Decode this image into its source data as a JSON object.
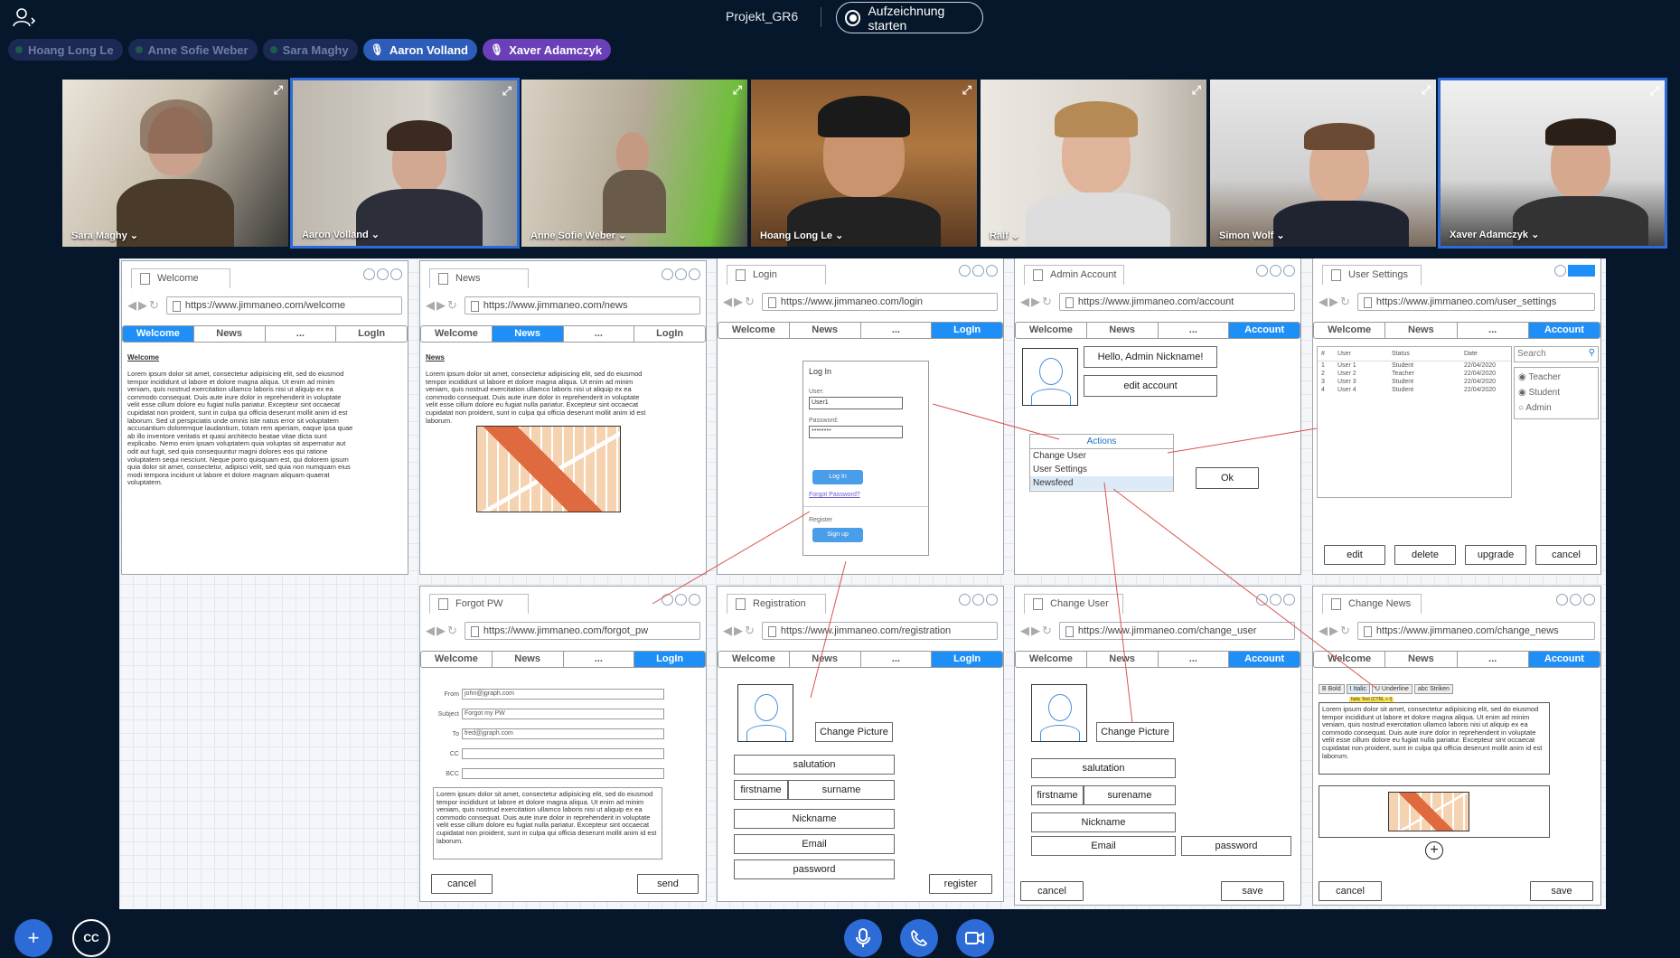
{
  "meeting": {
    "title": "Projekt_GR6",
    "record_label": "Aufzeichnung starten"
  },
  "speakers": [
    {
      "name": "Hoang Long Le",
      "style": "dim"
    },
    {
      "name": "Anne Sofie Weber",
      "style": "dim"
    },
    {
      "name": "Sara Maghy",
      "style": "dim"
    },
    {
      "name": "Aaron Volland",
      "style": "mic"
    },
    {
      "name": "Xaver Adamczyk",
      "style": "mic-purple"
    }
  ],
  "tiles": [
    {
      "name": "Sara Maghy ⌄"
    },
    {
      "name": "Aaron Volland ⌄"
    },
    {
      "name": "Anne Sofie Weber ⌄"
    },
    {
      "name": "Hoang Long Le ⌄"
    },
    {
      "name": "Ralf ⌄"
    },
    {
      "name": "Simon Wolf ⌄"
    },
    {
      "name": "Xaver Adamczyk ⌄"
    }
  ],
  "nav": {
    "welcome": "Welcome",
    "news": "News",
    "dots": "...",
    "login": "LogIn",
    "account": "Account"
  },
  "wireframes": {
    "welcome": {
      "tab": "Welcome",
      "url": "https://www.jimmaneo.com/welcome",
      "heading": "Welcome",
      "text": "Lorem ipsum dolor sit amet, consectetur adipisicing elit, sed do eiusmod tempor incididunt ut labore et dolore magna aliqua. Ut enim ad minim veniam, quis nostrud exercitation ullamco laboris nisi ut aliquip ex ea commodo consequat. Duis aute irure dolor in reprehenderit in voluptate velit esse cillum dolore eu fugiat nulla pariatur. Excepteur sint occaecat cupidatat non proident, sunt in culpa qui officia deserunt mollit anim id est laborum. Sed ut perspiciatis unde omnis iste natus error sit voluptatem accusantium doloremque laudantium, totam rem aperiam, eaque ipsa quae ab illo inventore veritatis et quasi architecto beatae vitae dicta sunt explicabo. Nemo enim ipsam voluptatem quia voluptas sit aspernatur aut odit aut fugit, sed quia consequuntur magni dolores eos qui ratione voluptatem sequi nesciunt. Neque porro quisquam est, qui dolorem ipsum quia dolor sit amet, consectetur, adipisci velit, sed quia non numquam eius modi tempora incidunt ut labore et dolore magnam aliquam quaerat voluptatem."
    },
    "news": {
      "tab": "News",
      "url": "https://www.jimmaneo.com/news",
      "heading": "News",
      "text": "Lorem ipsum dolor sit amet, consectetur adipisicing elit, sed do eiusmod tempor incididunt ut labore et dolore magna aliqua. Ut enim ad minim veniam, quis nostrud exercitation ullamco laboris nisi ut aliquip ex ea commodo consequat. Duis aute irure dolor in reprehenderit in voluptate velit esse cillum dolore eu fugiat nulla pariatur. Excepteur sint occaecat cupidatat non proident, sunt in culpa qui officia deserunt mollit anim id est laborum."
    },
    "login": {
      "tab": "Login",
      "url": "https://www.jimmaneo.com/login",
      "box_title": "Log In",
      "user_label": "User:",
      "user_value": "User1",
      "password_label": "Password:",
      "password_value": "********",
      "login_btn": "Log In",
      "forgot": "Forgot Password?",
      "register_label": "Register",
      "signup_btn": "Sign up"
    },
    "admin": {
      "tab": "Admin Account",
      "url": "https://www.jimmaneo.com/account",
      "hello": "Hello, Admin Nickname!",
      "edit": "edit account",
      "actions_title": "Actions",
      "actions": [
        "Change User",
        "User Settings",
        "Newsfeed"
      ],
      "ok": "Ok"
    },
    "user_settings": {
      "tab": "User Settings",
      "url": "https://www.jimmaneo.com/user_settings",
      "cols": [
        "#",
        "User",
        "Status",
        "Date"
      ],
      "rows": [
        [
          "1",
          "User 1",
          "Student",
          "22/04/2020"
        ],
        [
          "2",
          "User 2",
          "Teacher",
          "22/04/2020"
        ],
        [
          "3",
          "User 3",
          "Student",
          "22/04/2020"
        ],
        [
          "4",
          "User 4",
          "Student",
          "22/04/2020"
        ]
      ],
      "search": "Search",
      "roles": [
        "Teacher",
        "Student",
        "Admin"
      ],
      "buttons": [
        "edit",
        "delete",
        "upgrade",
        "cancel"
      ]
    },
    "forgot": {
      "tab": "Forgot PW",
      "url": "https://www.jimmaneo.com/forgot_pw",
      "fields": [
        {
          "label": "From",
          "value": "john@jgraph.com"
        },
        {
          "label": "Subject",
          "value": "Forgot my PW"
        },
        {
          "label": "To",
          "value": "fred@jgraph.com"
        },
        {
          "label": "CC",
          "value": ""
        },
        {
          "label": "BCC",
          "value": ""
        }
      ],
      "text": "Lorem ipsum dolor sit amet, consectetur adipisicing elit, sed do eiusmod tempor incididunt ut labore et dolore magna aliqua. Ut enim ad minim veniam, quis nostrud exercitation ullamco laboris nisi ut aliquip ex ea commodo consequat. Duis aute irure dolor in reprehenderit in voluptate velit esse cillum dolore eu fugiat nulla pariatur. Excepteur sint occaecat cupidatat non proident, sunt in culpa qui officia deserunt mollit anim id est laborum.",
      "cancel": "cancel",
      "send": "send"
    },
    "registration": {
      "tab": "Registration",
      "url": "https://www.jimmaneo.com/registration",
      "change_picture": "Change Picture",
      "salutation": "salutation",
      "firstname": "firstname",
      "surname": "surname",
      "nickname": "Nickname",
      "email": "Email",
      "password": "password",
      "register": "register"
    },
    "change_user": {
      "tab": "Change User",
      "url": "https://www.jimmaneo.com/change_user",
      "change_picture": "Change Picture",
      "salutation": "salutation",
      "firstname": "firstname",
      "surname": "surename",
      "nickname": "Nickname",
      "email": "Email",
      "password": "password",
      "cancel": "cancel",
      "save": "save"
    },
    "change_news": {
      "tab": "Change News",
      "url": "https://www.jimmaneo.com/change_news",
      "toolbar": [
        "B Bold",
        "I Italic",
        "U Underline",
        "abc Striken"
      ],
      "tooltip": "Italic Text (CTRL + I)",
      "text": "Lorem ipsum dolor sit amet, consectetur adipisicing elit, sed do eiusmod tempor incididunt ut labore et dolore magna aliqua. Ut enim ad minim veniam, quis nostrud exercitation ullamco laboris nisi ut aliquip ex ea commodo consequat. Duis aute irure dolor in reprehenderit in voluptate velit esse cillum dolore eu fugiat nulla pariatur. Excepteur sint occaecat cupidatat non proident, sunt in culpa qui officia deserunt mollit anim id est laborum.",
      "add": "+",
      "cancel": "cancel",
      "save": "save"
    }
  },
  "bottom": {
    "cc": "CC"
  },
  "colors": {
    "accent": "#1e8ff7",
    "bg": "#06172b",
    "connector": "#d9534f"
  }
}
